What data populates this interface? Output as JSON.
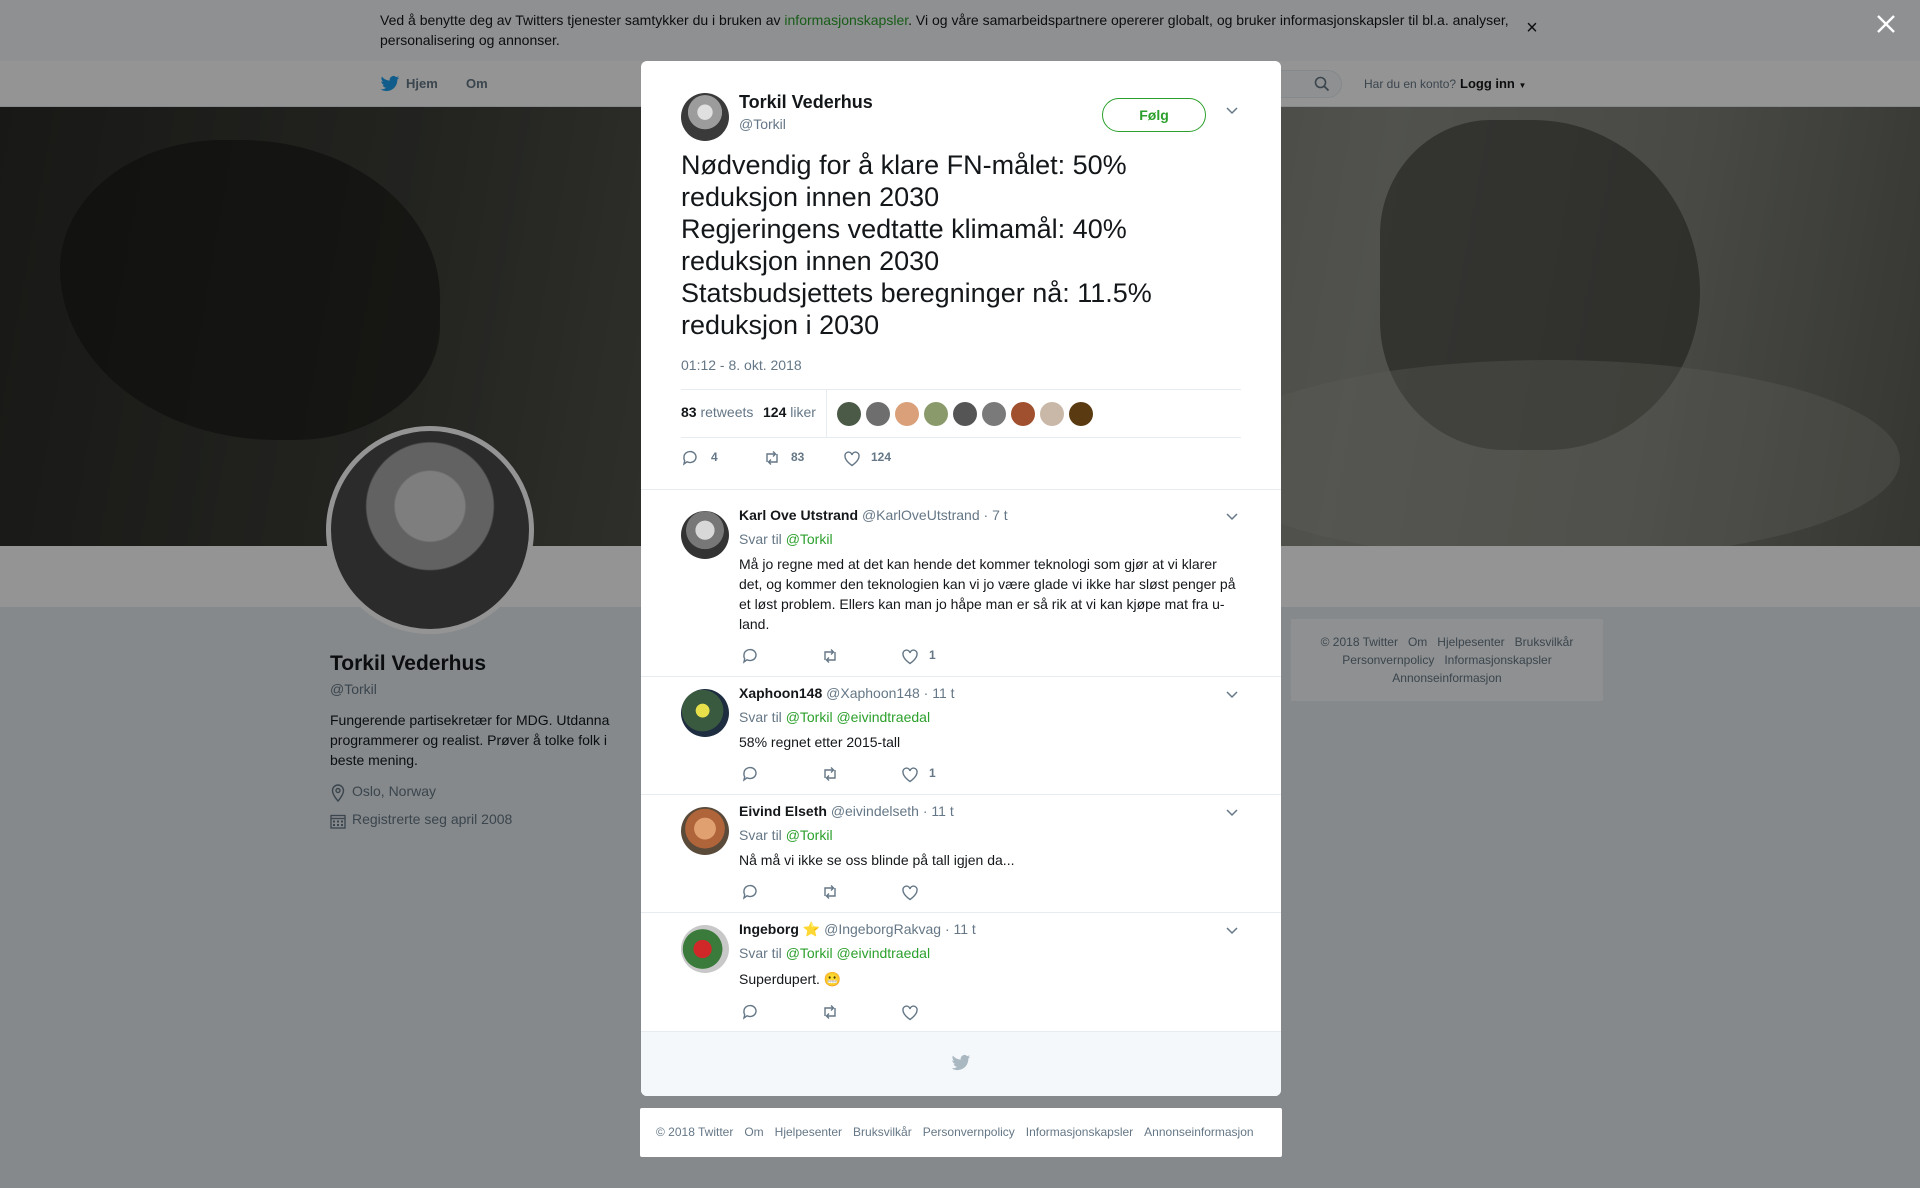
{
  "colors": {
    "accent": "#2ca02c",
    "text": "#14171a",
    "muted": "#657786",
    "border": "#e6ecf0"
  },
  "cookie": {
    "text_before": "Ved å benytte deg av Twitters tjenester samtykker du i bruken av ",
    "link": "informasjonskapsler",
    "text_after": ". Vi og våre samarbeidspartnere opererer globalt, og bruker informasjonskapsler til bl.a. analyser, personalisering og annonser.",
    "close": "×"
  },
  "nav": {
    "home": "Hjem",
    "about": "Om",
    "account_prompt": "Har du en konto?",
    "login": "Logg inn"
  },
  "profile": {
    "name": "Torkil Vederhus",
    "handle": "@Torkil",
    "bio": "Fungerende partisekretær for MDG. Utdanna programmerer og realist. Prøver å tolke folk i beste mening.",
    "location": "Oslo, Norway",
    "joined": "Registrerte seg april 2008"
  },
  "side_footer": [
    "© 2018 Twitter",
    "Om",
    "Hjelpesenter",
    "Bruksvilkår",
    "Personvernpolicy",
    "Informasjonskapsler",
    "Annonseinformasjon"
  ],
  "tweet": {
    "name": "Torkil Vederhus",
    "handle": "@Torkil",
    "follow": "Følg",
    "lines": [
      "Nødvendig for å klare FN-målet: 50%",
      "reduksjon innen 2030",
      "Regjeringens vedtatte klimamål: 40%",
      "reduksjon innen 2030",
      "Statsbudsjettets beregninger nå: 11.5%",
      "reduksjon i 2030"
    ],
    "time": "01:12 - 8. okt. 2018",
    "retweets_count": "83",
    "retweets_label": "retweets",
    "likes_count": "124",
    "likes_label": "liker",
    "actions": {
      "replies": "4",
      "retweets": "83",
      "likes": "124"
    }
  },
  "replies": [
    {
      "name": "Karl Ove Utstrand",
      "handle": "@KarlOveUtstrand",
      "time": "· 7 t",
      "to_label": "Svar til",
      "to": [
        "@Torkil"
      ],
      "text": "Må jo regne med at det kan hende det kommer teknologi som gjør at vi klarer det, og kommer den teknologien kan vi jo være glade vi ikke har sløst penger på et løst problem. Ellers kan man jo håpe man er så rik at vi kan kjøpe mat fra u-land.",
      "likes": "1"
    },
    {
      "name": "Xaphoon148",
      "handle": "@Xaphoon148",
      "time": "· 11 t",
      "to_label": "Svar til",
      "to": [
        "@Torkil",
        "@eivindtraedal"
      ],
      "text": "58% regnet etter 2015-tall",
      "likes": "1"
    },
    {
      "name": "Eivind Elseth",
      "handle": "@eivindelseth",
      "time": "· 11 t",
      "to_label": "Svar til",
      "to": [
        "@Torkil"
      ],
      "text": "Nå må vi ikke se oss blinde på tall igjen da...",
      "likes": ""
    },
    {
      "name": "Ingeborg",
      "star": "⭐",
      "handle": "@IngeborgRakvag",
      "time": "· 11 t",
      "to_label": "Svar til",
      "to": [
        "@Torkil",
        "@eivindtraedal"
      ],
      "text": "Superdupert.",
      "emoji": "😬",
      "likes": ""
    }
  ],
  "bottom_footer": [
    "© 2018 Twitter",
    "Om",
    "Hjelpesenter",
    "Bruksvilkår",
    "Personvernpolicy",
    "Informasjonskapsler",
    "Annonseinformasjon"
  ]
}
